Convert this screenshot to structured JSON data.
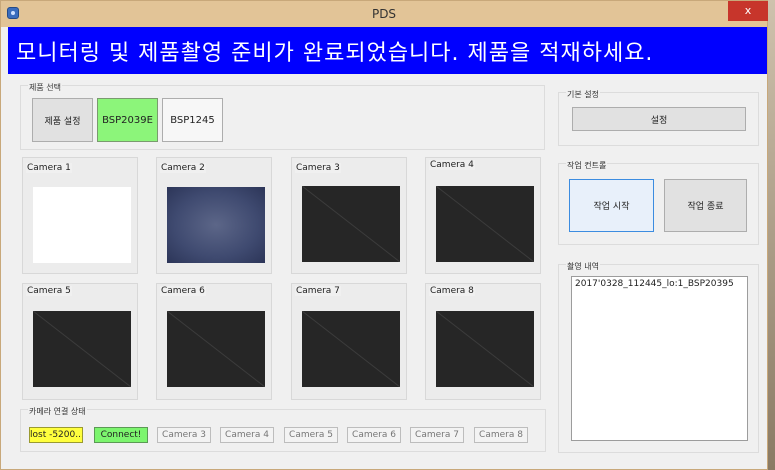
{
  "window": {
    "title": "PDS",
    "close_label": "x"
  },
  "banner": {
    "message": "모니터링 및 제품촬영 준비가 완료되었습니다. 제품을 적재하세요.",
    "background": "#0000ff"
  },
  "product_select": {
    "title": "제품 선택",
    "buttons": [
      "제품 설정",
      "BSP2039E",
      "BSP1245"
    ],
    "active_color": "#8cf57a"
  },
  "cameras": [
    {
      "label": "Camera 1",
      "state": "white"
    },
    {
      "label": "Camera 2",
      "state": "noise"
    },
    {
      "label": "Camera 3",
      "state": "empty"
    },
    {
      "label": "Camera 4",
      "state": "empty"
    },
    {
      "label": "Camera 5",
      "state": "empty"
    },
    {
      "label": "Camera 6",
      "state": "empty"
    },
    {
      "label": "Camera 7",
      "state": "empty"
    },
    {
      "label": "Camera 8",
      "state": "empty"
    }
  ],
  "connection": {
    "title": "카메라 연결 상태",
    "items": [
      {
        "label": "lost -5200...",
        "status": "warning",
        "color": "#ffff3d"
      },
      {
        "label": "Connect!",
        "status": "connected",
        "color": "#7cf56e"
      },
      {
        "label": "Camera 3",
        "status": "disabled"
      },
      {
        "label": "Camera 4",
        "status": "disabled"
      },
      {
        "label": "Camera 5",
        "status": "disabled"
      },
      {
        "label": "Camera 6",
        "status": "disabled"
      },
      {
        "label": "Camera 7",
        "status": "disabled"
      },
      {
        "label": "Camera 8",
        "status": "disabled"
      }
    ]
  },
  "basic_settings": {
    "title": "기본 설정",
    "settings_button": "설정"
  },
  "work_control": {
    "title": "작업 컨트롤",
    "start_button": "작업 시작",
    "end_button": "작업 종료"
  },
  "capture_history": {
    "title": "촬영 내역",
    "entries": [
      "2017'0328_112445_lo:1_BSP20395"
    ]
  }
}
